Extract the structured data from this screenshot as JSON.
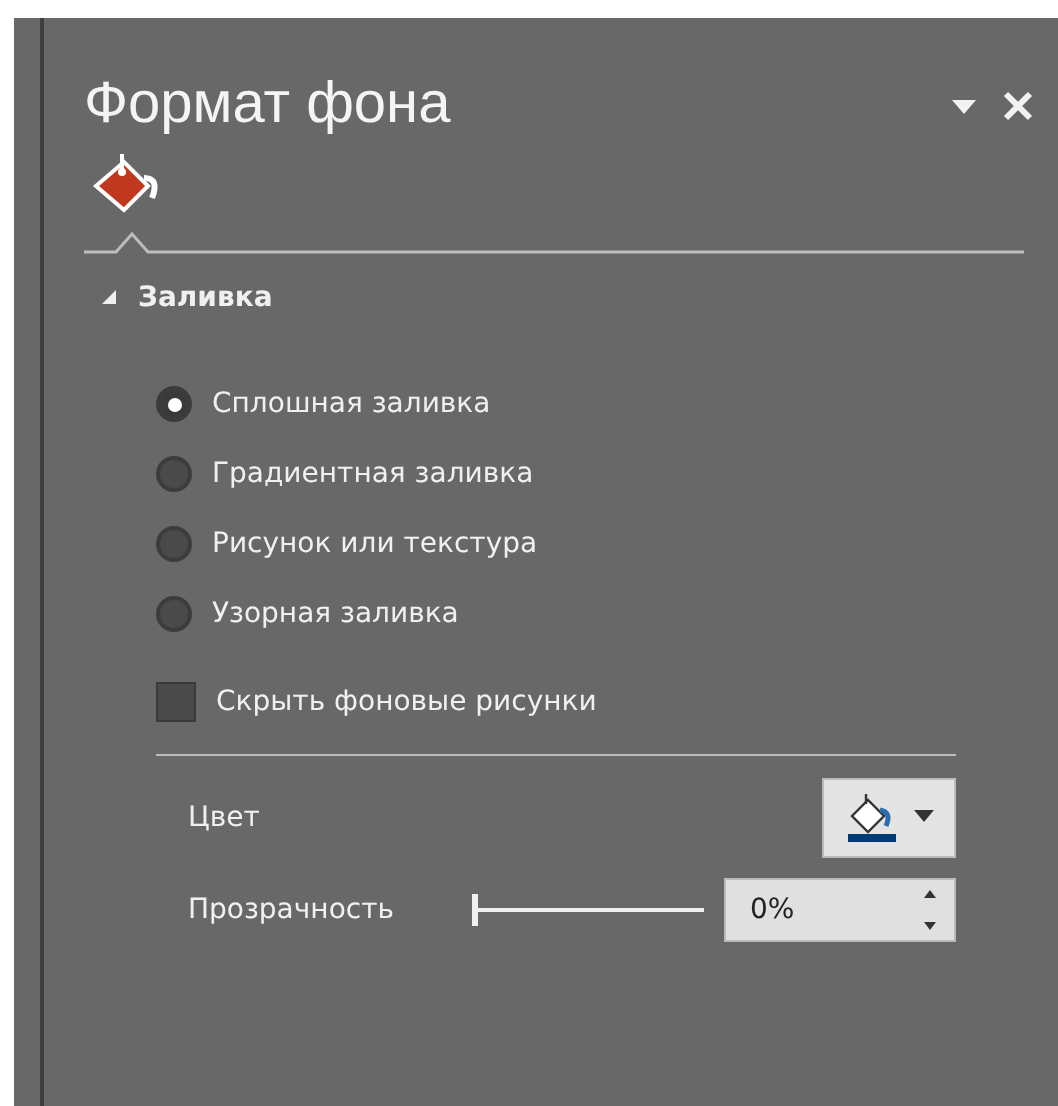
{
  "pane": {
    "title": "Формат фона"
  },
  "section": {
    "label": "Заливка",
    "expanded": true
  },
  "fill_options": [
    {
      "label": "Сплошная заливка",
      "selected": true
    },
    {
      "label": "Градиентная заливка",
      "selected": false
    },
    {
      "label": "Рисунок или текстура",
      "selected": false
    },
    {
      "label": "Узорная заливка",
      "selected": false
    }
  ],
  "hide_background": {
    "label": "Скрыть фоновые рисунки",
    "checked": false
  },
  "color": {
    "label": "Цвет"
  },
  "transparency": {
    "label": "Прозрачность",
    "level": 0,
    "value": "0%"
  }
}
